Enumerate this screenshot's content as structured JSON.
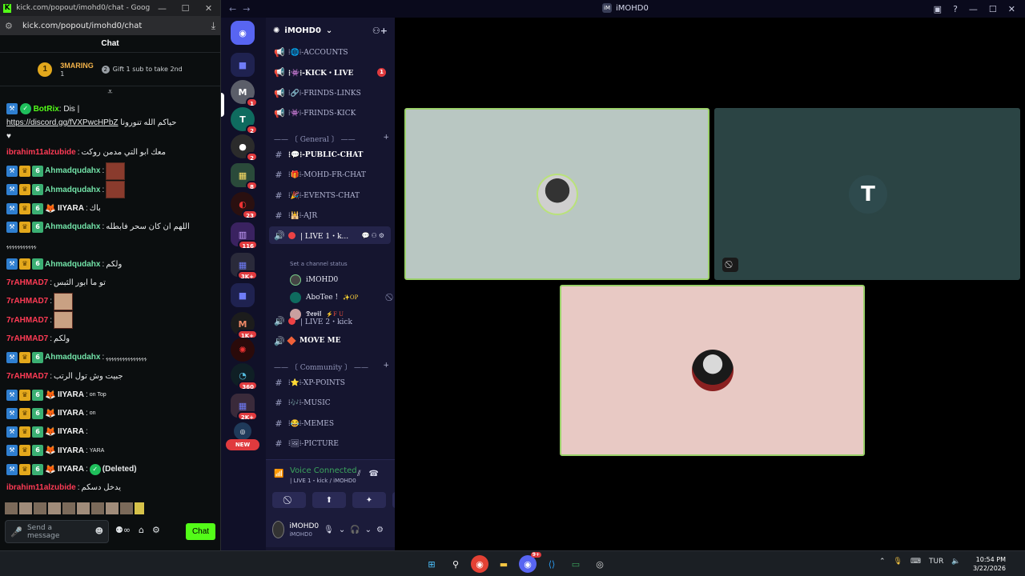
{
  "chrome": {
    "title": "kick.com/popout/imohd0/chat - Google Chr...",
    "url": "kick.com/popout/imohd0/chat",
    "controls": [
      "—",
      "☐",
      "✕"
    ]
  },
  "chat": {
    "header": "Chat",
    "leaderboard": {
      "rank": "1",
      "name": "3MARING",
      "count": "1",
      "gift_text": "Gift 1 sub to take 2nd",
      "gift_rank": "2"
    },
    "input_placeholder": "Send a message",
    "send_label": "Chat",
    "messages": [
      {
        "user": "BotRix",
        "text": "Dis |",
        "link": "https://discord.gg/fVXPwcHPbZ",
        "rtl": "حياكم الله تنورونا"
      },
      {
        "user": "ibrahim11alzubide",
        "text": "معك ابو التي مدمن روكت"
      },
      {
        "user": "Ahmadqudahx",
        "text": ""
      },
      {
        "user": "Ahmadqudahx",
        "text": ""
      },
      {
        "user": "IIYARA",
        "text": "باك"
      },
      {
        "user": "Ahmadqudahx",
        "text": "اللهم ان كان سحر فابطله"
      },
      {
        "text": "ﮩﮩﮩﮩﮩﮩﮩﮩﮩﮩﮩ"
      },
      {
        "user": "Ahmadqudahx",
        "text": "ولكم"
      },
      {
        "user": "7rAHMAD7",
        "text": "تو ما ابور الثبس"
      },
      {
        "user": "7rAHMAD7",
        "text": ""
      },
      {
        "user": "7rAHMAD7",
        "text": ""
      },
      {
        "user": "7rAHMAD7",
        "text": "ولكم"
      },
      {
        "user": "Ahmadqudahx",
        "text": "ﮩﮩﮩﮩﮩﮩﮩﮩﮩﮩﮩﮩﮩﮩﮩ"
      },
      {
        "user": "7rAHMAD7",
        "text": "جبيت وش تول الرتب"
      },
      {
        "user": "IIYARA",
        "text": "on Top"
      },
      {
        "user": "IIYARA",
        "text": "on"
      },
      {
        "user": "IIYARA",
        "text": ""
      },
      {
        "user": "IIYARA",
        "text": "YARA"
      },
      {
        "user": "IIYARA",
        "text": "(Deleted)"
      },
      {
        "user": "ibrahim11alzubide",
        "text": "يدخل دسكم"
      }
    ]
  },
  "discord": {
    "title": "iMOHD0",
    "server_name": "iMOHD0",
    "guild_badges": [
      "1",
      "2",
      "2",
      "8",
      "23",
      "116",
      "3K+",
      "1K+",
      "360",
      "2K+"
    ],
    "new_label": "NEW",
    "channels": {
      "accounts": "⁞🌐⁞-ACCOUNTS",
      "kick_live": "⁞👾⁞-KICK・LIVE",
      "kick_live_unread": "1",
      "frinds_links": "⁞🔗⁞-FRINDS-LINKS",
      "frinds_kick": "⁞👾⁞-FRINDS-KICK",
      "cat_general": "—— 〔 General 〕 ——",
      "public_chat": "⁞💬⁞-PUBLIC-CHAT",
      "mohd_fr_chat": "⁞🎁⁞-MOHD-FR-CHAT",
      "events_chat": "⁞🎉⁞-EVENTS-CHAT",
      "ajr": "⁞🕌⁞-AJR",
      "live1": "| LIVE 1・k...",
      "status": "Set a channel status",
      "live2": "| LIVE 2・kick",
      "move_me": "MOVE ME",
      "cat_community": "—— 〔 Community 〕 ——",
      "xp_points": "⁞⭐⁞-XP-POINTS",
      "music": "⁞🎶⁞-MUSIC",
      "memes": "⁞😂⁞-MEMES",
      "picture": "⁞🖼⁞-PICTURE"
    },
    "voice_users": [
      {
        "name": "iMOHD0",
        "tag": ""
      },
      {
        "name": "AboTee !",
        "tag": "✨OP"
      },
      {
        "name": "𝕯𝖊𝖛𝖎𝖑",
        "tag": "⚡F U"
      }
    ],
    "voice": {
      "status": "Voice Connected",
      "channel": "| LIVE 1・kick / iMOHD0"
    },
    "user": {
      "name": "iMOHD0",
      "sub": "iMOHD0"
    },
    "colors": {
      "accent": "#5865f2",
      "connected": "#3ba55d",
      "speaking": "#9bd16a"
    }
  },
  "taskbar": {
    "lang": "TUR",
    "time": "10:54 PM",
    "date": "3/22/2026",
    "discord_badge": "9+"
  }
}
